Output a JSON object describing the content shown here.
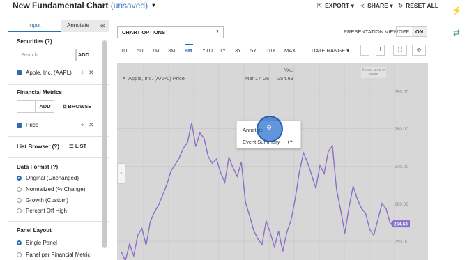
{
  "header": {
    "title": "New Fundamental Chart",
    "unsaved": "(unsaved)",
    "export_label": "EXPORT",
    "share_label": "SHARE",
    "reset_label": "RESET ALL"
  },
  "left_panel": {
    "tabs": [
      "Input",
      "Annotate"
    ],
    "securities": {
      "title": "Securities (?)",
      "search_placeholder": "Search",
      "add_label": "ADD",
      "items": [
        {
          "label": "Apple, Inc. (AAPL)",
          "checked": true
        }
      ]
    },
    "financial_metrics": {
      "title": "Financial Metrics",
      "add_label": "ADD",
      "browse_label": "BROWSE",
      "items": [
        {
          "label": "Price",
          "checked": true
        }
      ]
    },
    "list_browser": {
      "title": "List Browser (?)",
      "list_label": "LIST"
    },
    "data_format": {
      "title": "Data Format (?)",
      "options": [
        {
          "label": "Original (Unchanged)",
          "selected": true
        },
        {
          "label": "Normalized (% Change)",
          "selected": false
        },
        {
          "label": "Growth (Custom)",
          "selected": false
        },
        {
          "label": "Percent Off High",
          "selected": false
        }
      ]
    },
    "panel_layout": {
      "title": "Panel Layout",
      "options": [
        {
          "label": "Single Panel",
          "selected": true
        },
        {
          "label": "Panel per Financial Metric",
          "selected": false
        }
      ]
    }
  },
  "toolbar": {
    "chart_options_label": "CHART OPTIONS",
    "presentation_label": "PRESENTATION VIEW",
    "presentation_off": "OFF",
    "presentation_on": "ON",
    "ranges": [
      "1D",
      "5D",
      "1M",
      "3M",
      "6M",
      "YTD",
      "1Y",
      "3Y",
      "5Y",
      "10Y",
      "MAX"
    ],
    "active_range": "6M",
    "date_range_label": "DATE RANGE"
  },
  "chart_data": {
    "type": "line",
    "series": [
      {
        "name": "Apple, Inc. (AAPL) Price",
        "color": "#8a6fc9",
        "values": [
          247.2,
          244.8,
          249.3,
          246.1,
          251.7,
          253.4,
          248.9,
          255.2,
          257.8,
          259.6,
          262.3,
          265.1,
          268.7,
          270.4,
          272.2,
          274.8,
          276.3,
          281.6,
          275.2,
          278.9,
          277.4,
          272.6,
          270.8,
          271.9,
          268.3,
          265.7,
          272.4,
          269.6,
          267.3,
          271.1,
          260.4,
          256.8,
          252.9,
          250.6,
          249.1,
          255.4,
          252.2,
          248.5,
          252.7,
          247.3,
          252.4,
          255.6,
          261.2,
          268.4,
          273.5,
          271.0,
          267.6,
          264.1,
          270.2,
          268.0,
          273.9,
          275.4,
          263.8,
          258.3,
          252.1,
          258.9,
          264.7,
          261.3,
          258.8,
          257.5,
          253.2,
          251.6,
          255.8,
          260.1,
          258.6,
          254.63
        ]
      }
    ],
    "ylim": [
      245,
      292
    ],
    "y_ticks": [
      290,
      280,
      270,
      260,
      250
    ],
    "tooltip": {
      "date": "Mar 17 '26",
      "col_label": "VAL",
      "value": "254.63",
      "series_label": "Apple, Inc. (AAPL) Price"
    },
    "last_value_label": "254.63",
    "zoom_hint": "Select area to zoom",
    "grid": true
  },
  "context_menu": {
    "items": [
      "Annotate",
      "Event Summary"
    ]
  }
}
